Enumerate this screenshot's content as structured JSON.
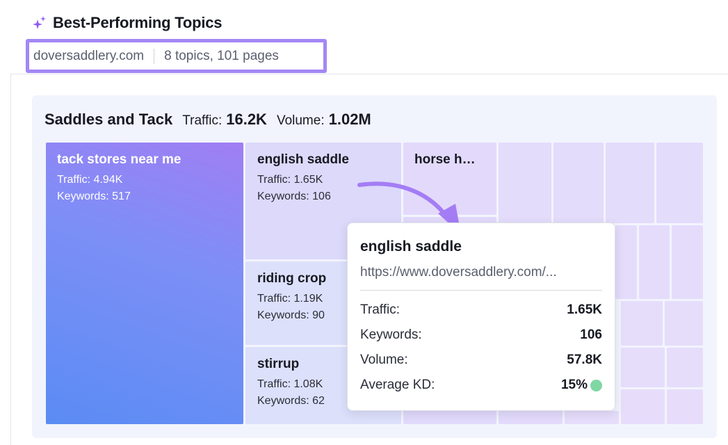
{
  "header": {
    "title": "Best-Performing Topics",
    "domain": "doversaddlery.com",
    "summary": "8 topics, 101 pages"
  },
  "topic": {
    "name": "Saddles and Tack",
    "traffic_label": "Traffic:",
    "traffic_value": "16.2K",
    "volume_label": "Volume:",
    "volume_value": "1.02M"
  },
  "tiles": [
    {
      "title": "tack stores near me",
      "traffic": "Traffic: 4.94K",
      "keywords": "Keywords: 517"
    },
    {
      "title": "english saddle",
      "traffic": "Traffic: 1.65K",
      "keywords": "Keywords: 106"
    },
    {
      "title": "horse h…"
    },
    {
      "title": "riding crop",
      "traffic": "Traffic: 1.19K",
      "keywords": "Keywords: 90"
    },
    {
      "title": "stirrup",
      "traffic": "Traffic: 1.08K",
      "keywords": "Keywords: 62"
    }
  ],
  "tooltip": {
    "title": "english saddle",
    "url": "https://www.doversaddlery.com/...",
    "rows": [
      {
        "label": "Traffic:",
        "value": "1.65K"
      },
      {
        "label": "Keywords:",
        "value": "106"
      },
      {
        "label": "Volume:",
        "value": "57.8K"
      },
      {
        "label": "Average KD:",
        "value": "15%"
      }
    ],
    "kd_color": "#7fd7a3"
  },
  "colors": {
    "highlight_border": "#a387f5",
    "arrow": "#a47df5",
    "card_bg": "#f2f4fd"
  },
  "icons": {
    "title_icon": "sparkle-icon"
  }
}
